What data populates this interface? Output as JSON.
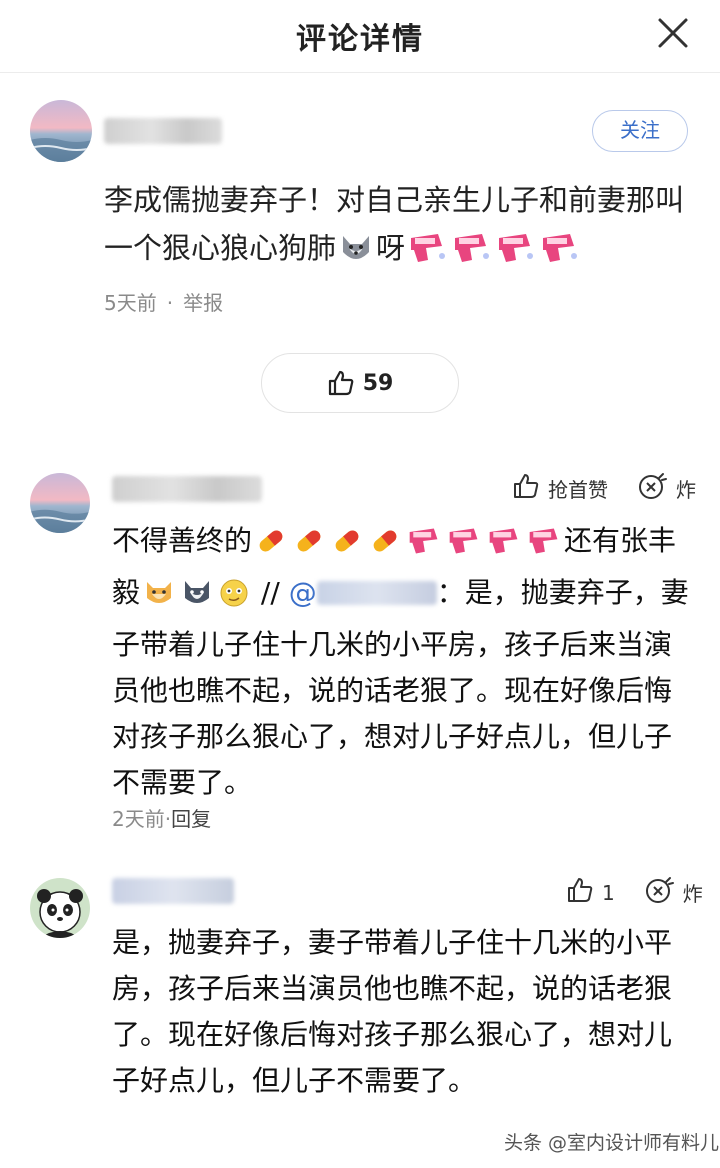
{
  "header": {
    "title": "评论详情",
    "close_icon": "close-icon"
  },
  "main_comment": {
    "follow_label": "关注",
    "text_before_emoji": "李成儒抛妻弃子！对自己亲生儿子和前妻那叫一个狠心狼心狗肺",
    "text_after_emoji": "呀",
    "time": "5天前",
    "separator": "·",
    "report_label": "举报",
    "like_count": "59"
  },
  "replies": [
    {
      "grab_label": "抢首赞",
      "bomb_label": "炸",
      "text_part1": "不得善终的",
      "text_part2": "还有张丰毅",
      "text_part3": " // ",
      "mention_prefix": "@",
      "text_part4": "：是，抛妻弃子，妻子带着儿子住十几米的小平房，孩子后来当演员他也瞧不起，说的话老狠了。现在好像后悔对孩子那么狠心了，想对儿子好点儿，但儿子不需要了。",
      "time": "2天前",
      "separator": "·",
      "reply_label": "回复"
    },
    {
      "like_count": "1",
      "bomb_label": "炸",
      "text": "是，抛妻弃子，妻子带着儿子住十几米的小平房，孩子后来当演员他也瞧不起，说的话老狠了。现在好像后悔对孩子那么狠心了，想对儿子好点儿，但儿子不需要了。"
    }
  ],
  "watermark": "头条 @室内设计师有料儿",
  "colors": {
    "accent_blue": "#3b6fc9",
    "muted_gray": "#8a8a8a",
    "sticker_pink": "#e8457f",
    "pill_yellow": "#f5b21c",
    "pill_red": "#e23b2e"
  }
}
